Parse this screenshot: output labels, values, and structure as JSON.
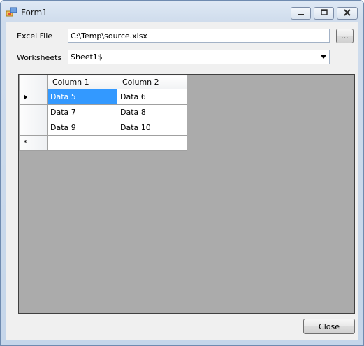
{
  "window": {
    "title": "Form1"
  },
  "form": {
    "excel_file_label": "Excel File",
    "excel_file_value": "C:\\Temp\\source.xlsx",
    "browse_label": "...",
    "worksheets_label": "Worksheets",
    "worksheet_selected": "Sheet1$",
    "close_label": "Close"
  },
  "grid": {
    "columns": [
      "Column 1",
      "Column 2"
    ],
    "rows": [
      [
        "Data 5",
        "Data 6"
      ],
      [
        "Data 7",
        "Data 8"
      ],
      [
        "Data 9",
        "Data 10"
      ]
    ],
    "new_row_marker": "*"
  },
  "icons": {
    "app": "app-form-icon",
    "minimize": "minimize-icon",
    "maximize": "maximize-icon",
    "close": "close-icon",
    "current_row": "current-row-arrow-icon",
    "dropdown": "chevron-down-icon"
  }
}
